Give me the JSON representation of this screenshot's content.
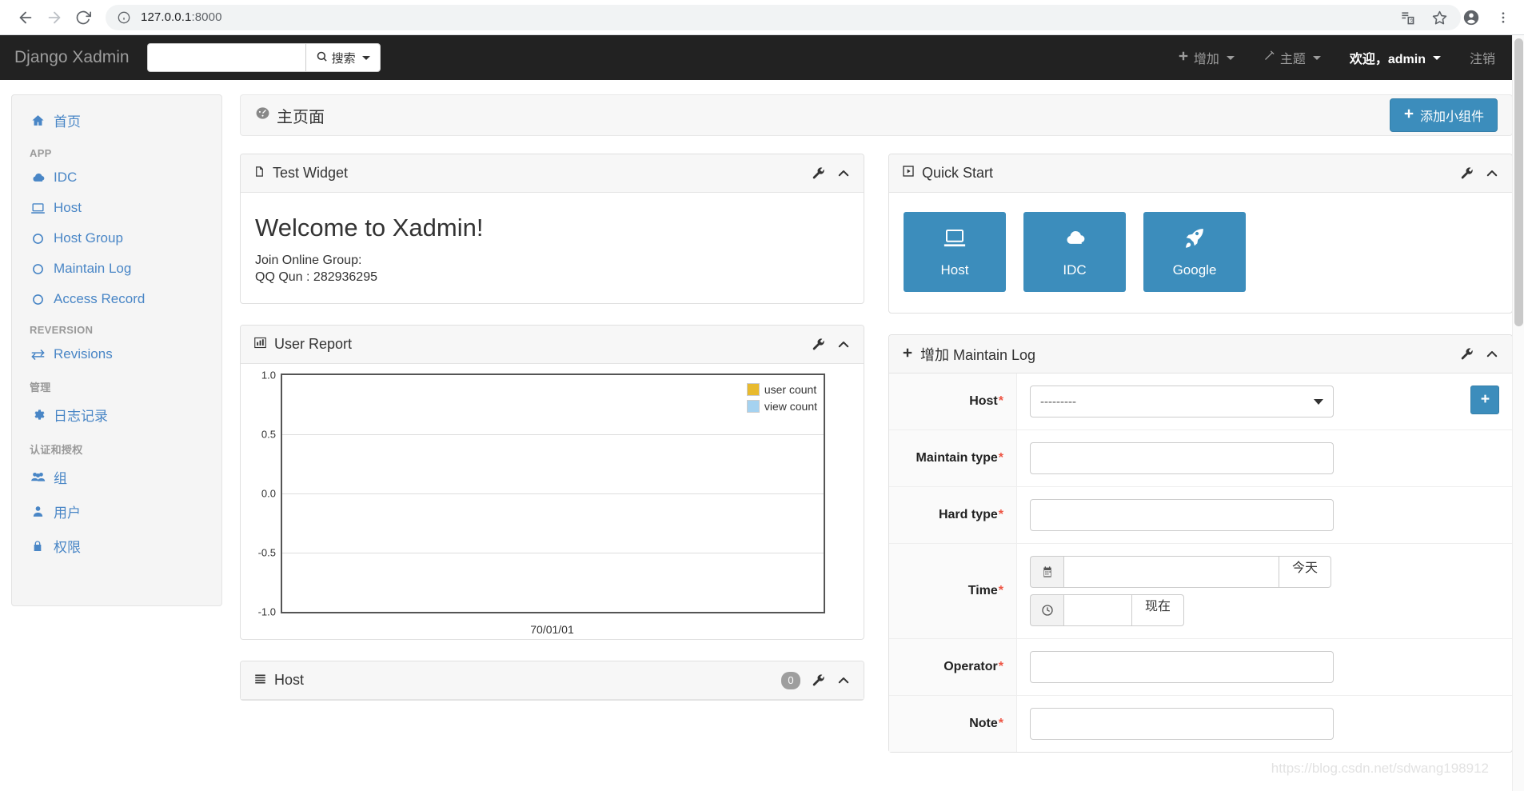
{
  "browser": {
    "back_icon": "back-arrow-icon",
    "forward_icon": "forward-arrow-icon",
    "reload_icon": "reload-icon",
    "info_icon": "info-circle-icon",
    "url": "127.0.0.1:8000",
    "url_host": "127.0.0.1",
    "url_port": ":8000",
    "translate_icon": "translate-icon",
    "bookmark_icon": "star-icon",
    "profile_icon": "account-circle-icon",
    "menu_icon": "three-dot-menu-icon"
  },
  "navbar": {
    "brand": "Django Xadmin",
    "search_placeholder": "",
    "search_value": "",
    "search_button": "搜索",
    "links": [
      {
        "label": "增加",
        "icon": "plus-icon",
        "caret": true,
        "strong": false
      },
      {
        "label": "主题",
        "icon": "magic-wand-icon",
        "caret": true,
        "strong": false
      },
      {
        "label": "欢迎，admin",
        "icon": "",
        "caret": true,
        "strong": true
      },
      {
        "label": "注销",
        "icon": "",
        "caret": false,
        "strong": false
      }
    ]
  },
  "sidebar": {
    "items": [
      {
        "type": "link",
        "label": "首页",
        "icon": "home-icon"
      },
      {
        "type": "header",
        "label": "APP"
      },
      {
        "type": "link",
        "label": "IDC",
        "icon": "cloud-icon"
      },
      {
        "type": "link",
        "label": "Host",
        "icon": "laptop-icon"
      },
      {
        "type": "link",
        "label": "Host Group",
        "icon": "circle-o-icon"
      },
      {
        "type": "link",
        "label": "Maintain Log",
        "icon": "circle-o-icon"
      },
      {
        "type": "link",
        "label": "Access Record",
        "icon": "circle-o-icon"
      },
      {
        "type": "header",
        "label": "REVERSION"
      },
      {
        "type": "link",
        "label": "Revisions",
        "icon": "exchange-icon"
      },
      {
        "type": "header",
        "label": "管理"
      },
      {
        "type": "link",
        "label": "日志记录",
        "icon": "gear-icon"
      },
      {
        "type": "header",
        "label": "认证和授权"
      },
      {
        "type": "link",
        "label": "组",
        "icon": "group-icon"
      },
      {
        "type": "link",
        "label": "用户",
        "icon": "user-icon"
      },
      {
        "type": "link",
        "label": "权限",
        "icon": "lock-icon"
      }
    ]
  },
  "breadcrumb": {
    "title": "主页面",
    "icon": "dashboard-icon",
    "add_widget_button": "添加小组件",
    "add_widget_icon": "plus-icon"
  },
  "panels": {
    "test_widget": {
      "title": "Test Widget",
      "icon": "file-icon",
      "wrench_icon": "wrench-icon",
      "collapse_icon": "chevron-up-icon",
      "heading": "Welcome to Xadmin!",
      "line1": "Join Online Group:",
      "line2": "QQ Qun : 282936295"
    },
    "user_report": {
      "title": "User Report",
      "icon": "bar-chart-icon",
      "wrench_icon": "wrench-icon",
      "collapse_icon": "chevron-up-icon"
    },
    "quick_start": {
      "title": "Quick Start",
      "icon": "play-box-icon",
      "wrench_icon": "wrench-icon",
      "collapse_icon": "chevron-up-icon",
      "tiles": [
        {
          "label": "Host",
          "icon": "laptop-icon"
        },
        {
          "label": "IDC",
          "icon": "cloud-icon"
        },
        {
          "label": "Google",
          "icon": "rocket-icon"
        }
      ]
    },
    "maintain_log": {
      "title_prefix": "增加",
      "title": "增加 Maintain Log",
      "model_name": "Maintain Log",
      "icon": "plus-icon",
      "wrench_icon": "wrench-icon",
      "collapse_icon": "chevron-up-icon",
      "add_related_icon": "plus-icon",
      "fields": [
        {
          "label": "Host",
          "required": true,
          "type": "select",
          "value": "---------",
          "has_add": true
        },
        {
          "label": "Maintain type",
          "required": true,
          "type": "text",
          "value": ""
        },
        {
          "label": "Hard type",
          "required": true,
          "type": "text",
          "value": ""
        },
        {
          "label": "Time",
          "required": true,
          "type": "datetime",
          "date_value": "",
          "date_button": "今天",
          "date_icon": "calendar-icon",
          "time_value": "",
          "time_button": "现在",
          "time_icon": "clock-icon"
        },
        {
          "label": "Operator",
          "required": true,
          "type": "text",
          "value": ""
        },
        {
          "label": "Note",
          "required": true,
          "type": "text",
          "value": ""
        }
      ]
    },
    "host_list": {
      "title": "Host",
      "icon": "list-icon",
      "count": "0",
      "wrench_icon": "wrench-icon",
      "collapse_icon": "chevron-up-icon"
    }
  },
  "chart_data": {
    "type": "bar",
    "title": "User Report",
    "categories": [
      "70/01/01"
    ],
    "series": [
      {
        "name": "user count",
        "color": "#e8ba2e",
        "values": [
          0
        ]
      },
      {
        "name": "view count",
        "color": "#a5d2f0",
        "values": [
          0
        ]
      }
    ],
    "xlabel": "",
    "ylabel": "",
    "ylim": [
      -1.0,
      1.0
    ],
    "yticks": [
      1.0,
      0.5,
      0.0,
      -0.5,
      -1.0
    ],
    "ytick_labels": [
      "1.0",
      "0.5",
      "0.0",
      "-0.5",
      "-1.0"
    ],
    "xtick_labels": [
      "70/01/01"
    ],
    "grid": true,
    "legend_position": "top-right"
  },
  "watermark": "https://blog.csdn.net/sdwang198912"
}
